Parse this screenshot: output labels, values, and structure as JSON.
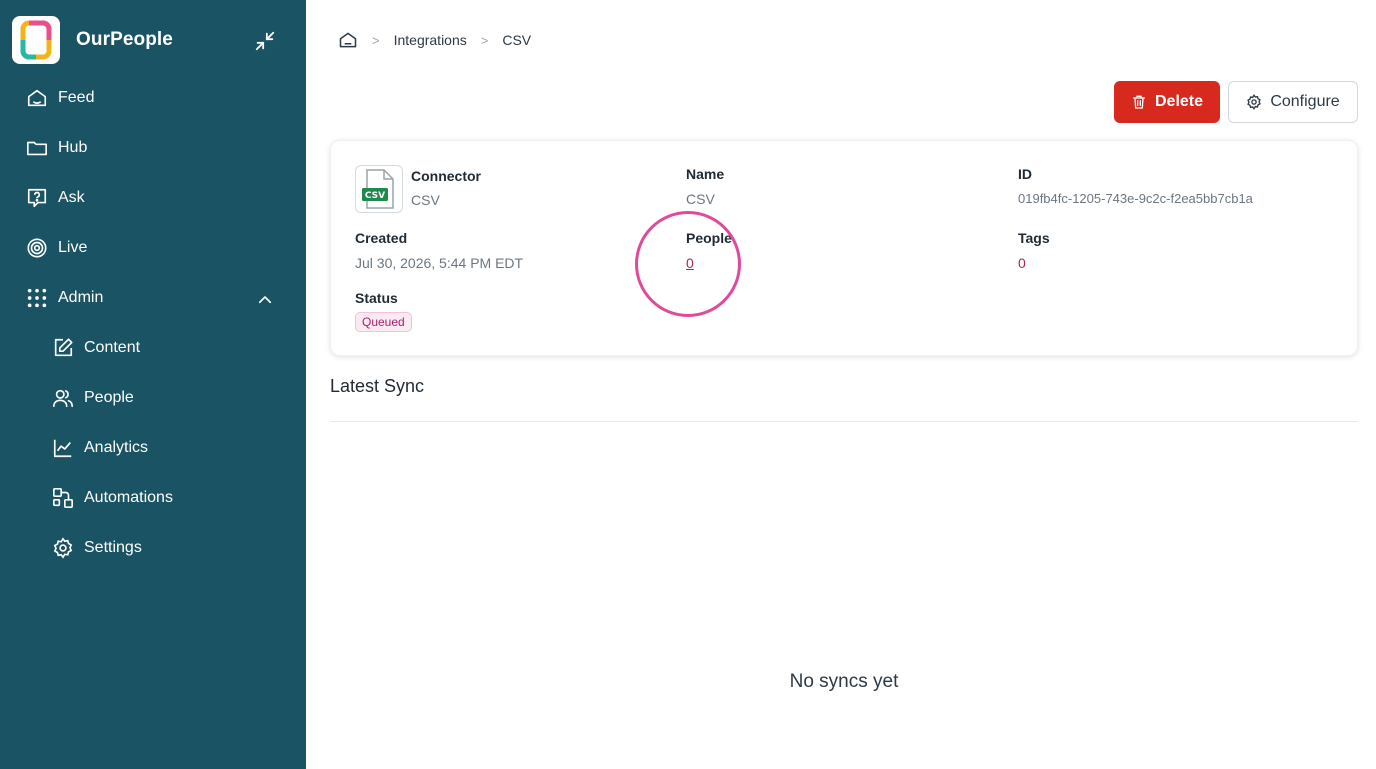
{
  "app": {
    "name": "OurPeople"
  },
  "sidebar": {
    "items": [
      {
        "label": "Feed"
      },
      {
        "label": "Hub"
      },
      {
        "label": "Ask"
      },
      {
        "label": "Live"
      },
      {
        "label": "Admin"
      },
      {
        "label": "Content"
      },
      {
        "label": "People"
      },
      {
        "label": "Analytics"
      },
      {
        "label": "Automations"
      },
      {
        "label": "Settings"
      }
    ]
  },
  "breadcrumb": {
    "sep": ">",
    "items": [
      "Integrations",
      "CSV"
    ]
  },
  "actions": {
    "delete_label": "Delete",
    "configure_label": "Configure"
  },
  "details": {
    "connector_label": "Connector",
    "connector_value": "CSV",
    "icon_text": "CSV",
    "name_label": "Name",
    "name_value": "CSV",
    "id_label": "ID",
    "id_value": "019fb4fc-1205-743e-9c2c-f2ea5bb7cb1a",
    "created_label": "Created",
    "created_value": "Jul 30, 2026, 5:44 PM EDT",
    "people_label": "People",
    "people_value": "0",
    "tags_label": "Tags",
    "tags_value": "0",
    "status_label": "Status",
    "status_value": "Queued"
  },
  "latest_sync": {
    "title": "Latest Sync",
    "empty_text": "No syncs yet"
  },
  "colors": {
    "sidebar_bg": "#1a5363",
    "delete_bg": "#d7291e",
    "accent_pink": "#b0245c"
  }
}
